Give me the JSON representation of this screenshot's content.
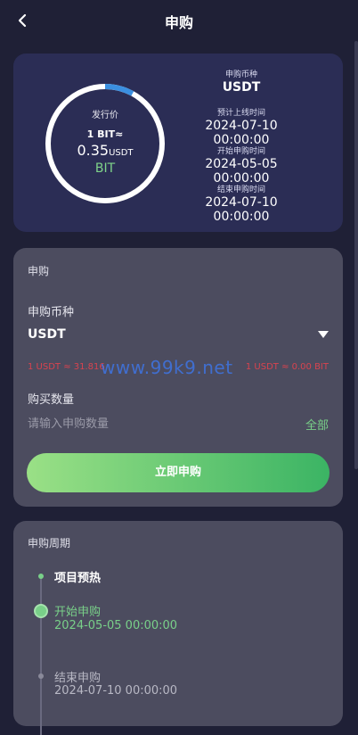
{
  "header": {
    "title": "申购"
  },
  "info_card": {
    "ring_label": "发行价",
    "rate_text": "1 BIT≈",
    "price_value": "0.35",
    "price_unit": "USDT",
    "coin": "BIT",
    "progress_percent": 8,
    "items": [
      {
        "label": "申购币种",
        "value": "USDT"
      },
      {
        "label": "预计上线时间",
        "value": "2024-07-10 00:00:00"
      },
      {
        "label": "开始申购时间",
        "value": "2024-05-05 00:00:00"
      },
      {
        "label": "结束申购时间",
        "value": "2024-07-10 00:00:00"
      }
    ]
  },
  "subscribe": {
    "section_title": "申购",
    "currency_label": "申购币种",
    "currency_value": "USDT",
    "rate_left": "1 USDT ≈ 31.816",
    "rate_right": "1 USDT ≈ 0.00 BIT",
    "watermark": "www.99k9.net",
    "quantity_label": "购买数量",
    "quantity_placeholder": "请输入申购数量",
    "quantity_value": "",
    "all_label": "全部",
    "submit_label": "立即申购"
  },
  "cycle": {
    "section_title": "申购周期",
    "steps": [
      {
        "title": "项目预热",
        "date": ""
      },
      {
        "title": "开始申购",
        "date": "2024-05-05 00:00:00"
      },
      {
        "title": "结束申购",
        "date": "2024-07-10 00:00:00"
      }
    ]
  },
  "colors": {
    "accent_green": "#79d089",
    "ring_progress": "#3b8fe0",
    "rate_red": "#d8434f"
  }
}
